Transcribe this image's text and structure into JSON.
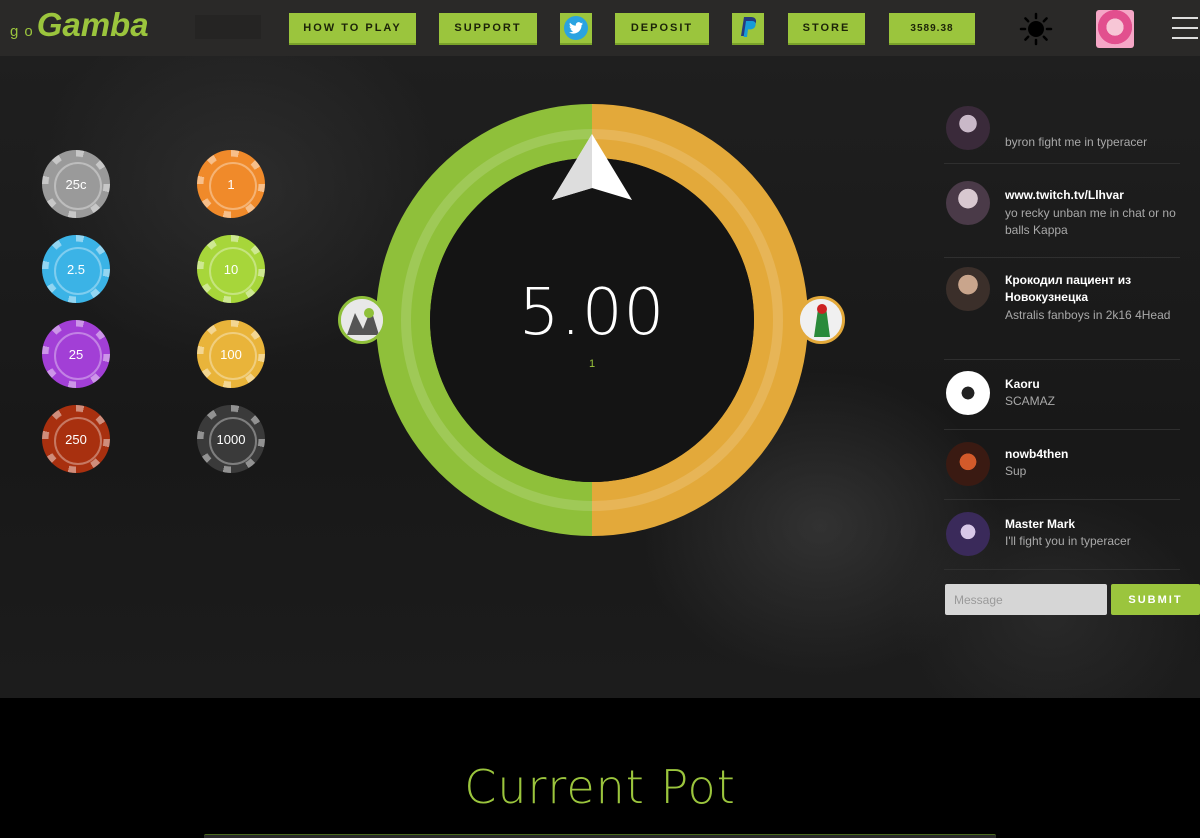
{
  "header": {
    "logo_prefix": "go",
    "logo_name": "Gamba",
    "nav": {
      "how_to_play": "HOW TO PLAY",
      "support": "SUPPORT",
      "deposit": "DEPOSIT",
      "store": "STORE",
      "balance": "3589.38"
    },
    "icons": [
      "twitter-icon",
      "paypal-icon",
      "sun-icon",
      "menu-icon"
    ]
  },
  "chips": [
    {
      "label": "25c",
      "color": "#9a9a9a"
    },
    {
      "label": "1",
      "color": "#f08a2a"
    },
    {
      "label": "2.5",
      "color": "#3bb3e6"
    },
    {
      "label": "10",
      "color": "#a7d63a"
    },
    {
      "label": "25",
      "color": "#a23fd6"
    },
    {
      "label": "100",
      "color": "#e9b43a"
    },
    {
      "label": "250",
      "color": "#a8300f"
    },
    {
      "label": "1000",
      "color": "#3a3a3a"
    }
  ],
  "wheel": {
    "timer": "5.00",
    "round": "1",
    "segments": [
      {
        "side": "left",
        "share": 0.5,
        "color": "#8fc03a"
      },
      {
        "side": "right",
        "share": 0.5,
        "color": "#e3a93a"
      }
    ]
  },
  "chat": {
    "messages": [
      {
        "name": "",
        "text": "byron fight me in typeracer"
      },
      {
        "name": "www.twitch.tv/Llhvar",
        "text": "yo recky unban me in chat or no balls Kappa"
      },
      {
        "name": "Крокодил пациент из Новокузнецка",
        "text": "Astralis fanboys in 2k16 4Head"
      },
      {
        "name": "Kaoru",
        "text": "SCAMAZ"
      },
      {
        "name": "nowb4then",
        "text": "Sup"
      },
      {
        "name": "Master Mark",
        "text": "I'll fight you in typeracer"
      }
    ],
    "input_placeholder": "Message",
    "submit_label": "SUBMIT"
  },
  "pot": {
    "title": "Current Pot"
  }
}
